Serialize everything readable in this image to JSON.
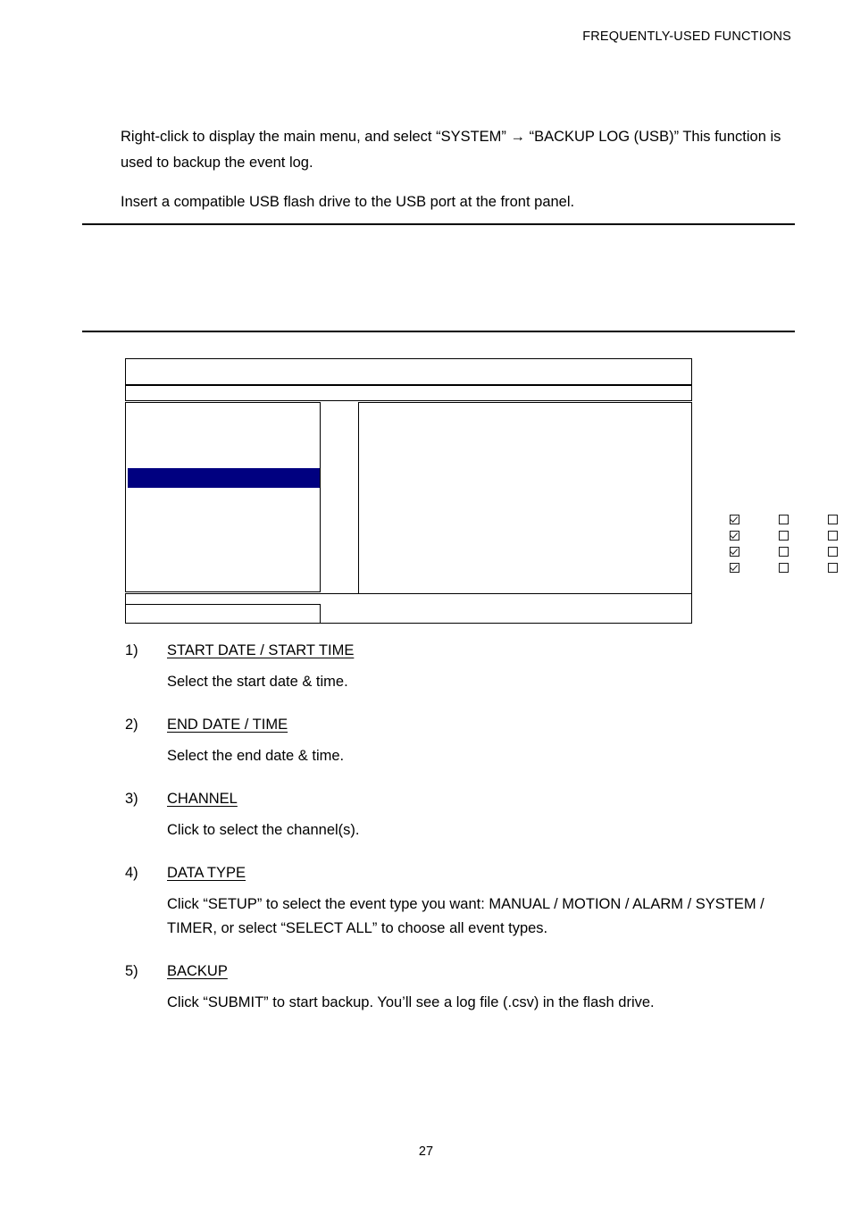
{
  "header": {
    "running_title": "FREQUENTLY-USED FUNCTIONS"
  },
  "body": {
    "intro_paragraph": "Right-click to display the main menu, and select “SYSTEM” → “BACKUP LOG (USB)” This function is used to backup the event log.",
    "usb_paragraph": "Insert a compatible USB flash drive to the USB port at the front panel."
  },
  "dialog": {
    "name": "backup-log-usb-dialog",
    "highlight_color": "#000080",
    "border_color": "#000000",
    "checkbox_grid": {
      "rows": 4,
      "columns": 4,
      "checked": [
        [
          true,
          false,
          false,
          false
        ],
        [
          true,
          false,
          false,
          false
        ],
        [
          true,
          false,
          false,
          false
        ],
        [
          true,
          false,
          false,
          false
        ]
      ]
    }
  },
  "steps": [
    {
      "number": "1)",
      "title": "START DATE / START TIME",
      "body": "Select the start date & time."
    },
    {
      "number": "2)",
      "title": "END DATE / TIME",
      "body": "Select the end date & time."
    },
    {
      "number": "3)",
      "title": "CHANNEL",
      "body": "Click to select the channel(s)."
    },
    {
      "number": "4)",
      "title": "DATA TYPE",
      "body": "Click “SETUP” to select the event type you want: MANUAL / MOTION / ALARM / SYSTEM / TIMER, or select “SELECT ALL” to choose all event types."
    },
    {
      "number": "5)",
      "title": "BACKUP",
      "body": "Click “SUBMIT” to start backup. You’ll see a log file (.csv) in the flash drive."
    }
  ],
  "footer": {
    "page_number": "27"
  }
}
